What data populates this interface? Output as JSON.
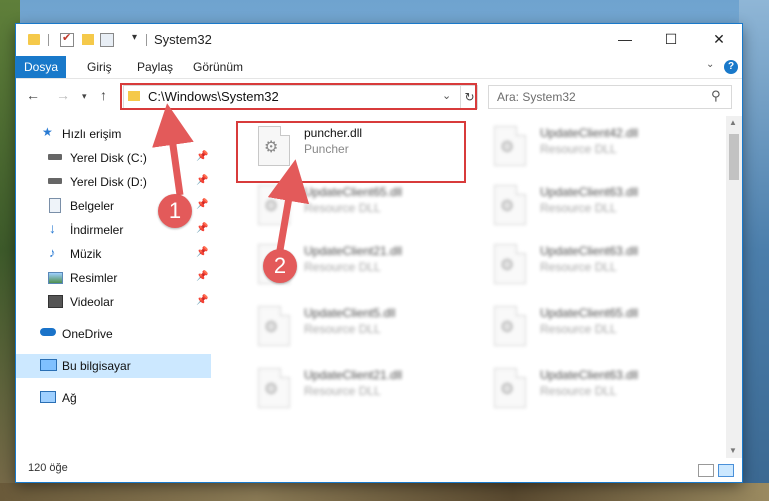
{
  "title_bar": {
    "title": "System32",
    "minimize": "—",
    "maximize": "☐",
    "close": "✕"
  },
  "ribbon": {
    "tabs": [
      {
        "label": "Dosya"
      },
      {
        "label": "Giriş"
      },
      {
        "label": "Paylaş"
      },
      {
        "label": "Görünüm"
      }
    ],
    "help": "?"
  },
  "navigation": {
    "address": "C:\\Windows\\System32",
    "search_placeholder": "Ara: System32"
  },
  "sidebar": {
    "items": [
      {
        "label": "Hızlı erişim",
        "icon": "star-icon"
      },
      {
        "label": "Yerel Disk (C:)",
        "icon": "drive-icon",
        "pinned": true
      },
      {
        "label": "Yerel Disk (D:)",
        "icon": "drive-icon",
        "pinned": true
      },
      {
        "label": "Belgeler",
        "icon": "documents-icon",
        "pinned": true
      },
      {
        "label": "İndirmeler",
        "icon": "download-icon",
        "pinned": true
      },
      {
        "label": "Müzik",
        "icon": "music-icon",
        "pinned": true
      },
      {
        "label": "Resimler",
        "icon": "pictures-icon",
        "pinned": true
      },
      {
        "label": "Videolar",
        "icon": "videos-icon",
        "pinned": true
      },
      {
        "label": "OneDrive",
        "icon": "cloud-icon"
      },
      {
        "label": "Bu bilgisayar",
        "icon": "computer-icon",
        "selected": true
      },
      {
        "label": "Ağ",
        "icon": "network-icon"
      }
    ]
  },
  "files": [
    {
      "name": "puncher.dll",
      "type": "Puncher"
    },
    {
      "name": "UpdateClient42.dll",
      "type": "Resource DLL"
    },
    {
      "name": "UpdateClient65.dll",
      "type": "Resource DLL"
    },
    {
      "name": "UpdateClient63.dll",
      "type": "Resource DLL"
    },
    {
      "name": "UpdateClient21.dll",
      "type": "Resource DLL"
    },
    {
      "name": "UpdateClient63.dll",
      "type": "Resource DLL"
    },
    {
      "name": "UpdateClient5.dll",
      "type": "Resource DLL"
    },
    {
      "name": "UpdateClient65.dll",
      "type": "Resource DLL"
    },
    {
      "name": "UpdateClient21.dll",
      "type": "Resource DLL"
    },
    {
      "name": "UpdateClient63.dll",
      "type": "Resource DLL"
    }
  ],
  "status": {
    "item_count": "120 öğe"
  },
  "annotations": {
    "marker1": "1",
    "marker2": "2",
    "color": "#d83b3b"
  }
}
